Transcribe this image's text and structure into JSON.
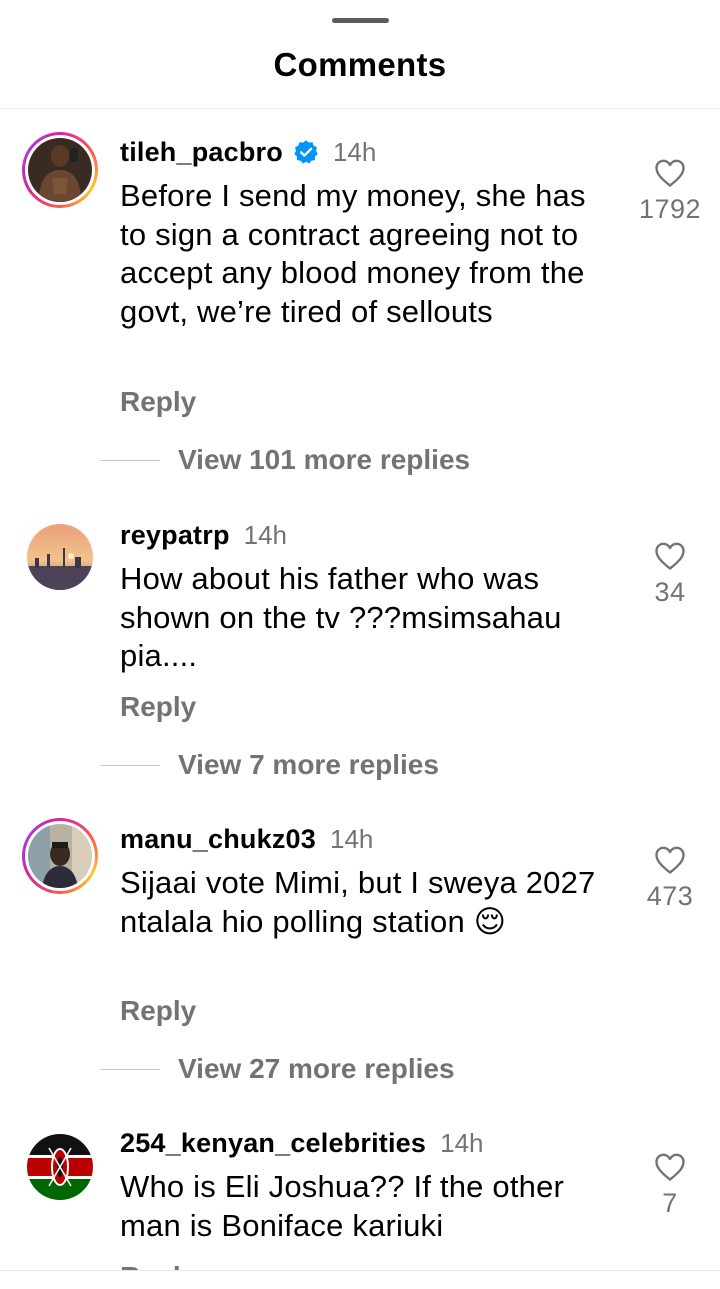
{
  "title": "Comments",
  "comments": [
    {
      "username": "tileh_pacbro",
      "verified": true,
      "time": "14h",
      "text": "Before I send my money, she has to sign a contract agreeing not to accept any blood money from the govt, we’re tired of sellouts",
      "reply_label": "Reply",
      "more_replies": "View 101 more replies",
      "likes": "1792"
    },
    {
      "username": "reypatrp",
      "verified": false,
      "time": "14h",
      "text": "How about his father who was shown on the tv ???msimsahau pia....",
      "reply_label": "Reply",
      "more_replies": "View 7 more replies",
      "likes": "34"
    },
    {
      "username": "manu_chukz03",
      "verified": false,
      "time": "14h",
      "text": "Sijaai vote Mimi, but I sweya 2027 ntalala hio polling station 😌",
      "reply_label": "Reply",
      "more_replies": "View 27 more replies",
      "likes": "473"
    },
    {
      "username": "254_kenyan_celebrities",
      "verified": false,
      "time": "14h",
      "text": "Who is Eli Joshua?? If the other man is Boniface kariuki",
      "reply_label": "Reply",
      "likes": "7"
    }
  ],
  "colors": {
    "verified_badge": "#0095f6",
    "secondary_text": "#737373"
  },
  "icons": {
    "like": "heart-outline-icon",
    "verified": "verified-badge-icon"
  }
}
